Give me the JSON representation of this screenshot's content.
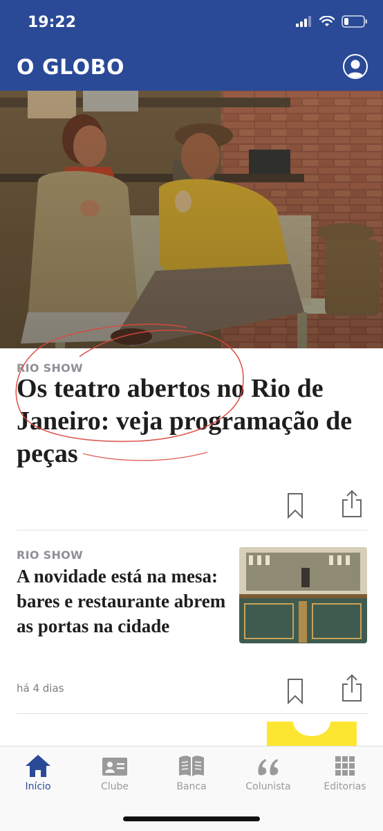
{
  "status_bar": {
    "time": "19:22"
  },
  "header": {
    "logo": "O GLOBO"
  },
  "articles": [
    {
      "kicker": "RIO SHOW",
      "headline": "Os teatro abertos no Rio de Janeiro: veja programação de peças"
    },
    {
      "kicker": "RIO SHOW",
      "headline": "A novidade está na mesa: bares e restaurante abrem as portas na cidade",
      "age": "há 4 dias"
    }
  ],
  "tabs": [
    {
      "label": "Início",
      "icon": "home-icon",
      "active": true
    },
    {
      "label": "Clube",
      "icon": "member-card-icon",
      "active": false
    },
    {
      "label": "Banca",
      "icon": "open-book-icon",
      "active": false
    },
    {
      "label": "Colunista",
      "icon": "quote-icon",
      "active": false
    },
    {
      "label": "Editorias",
      "icon": "grid-icon",
      "active": false
    }
  ],
  "colors": {
    "brand": "#2a4a97",
    "accent_yellow": "#fde631",
    "annotation_red": "#d9473e"
  }
}
